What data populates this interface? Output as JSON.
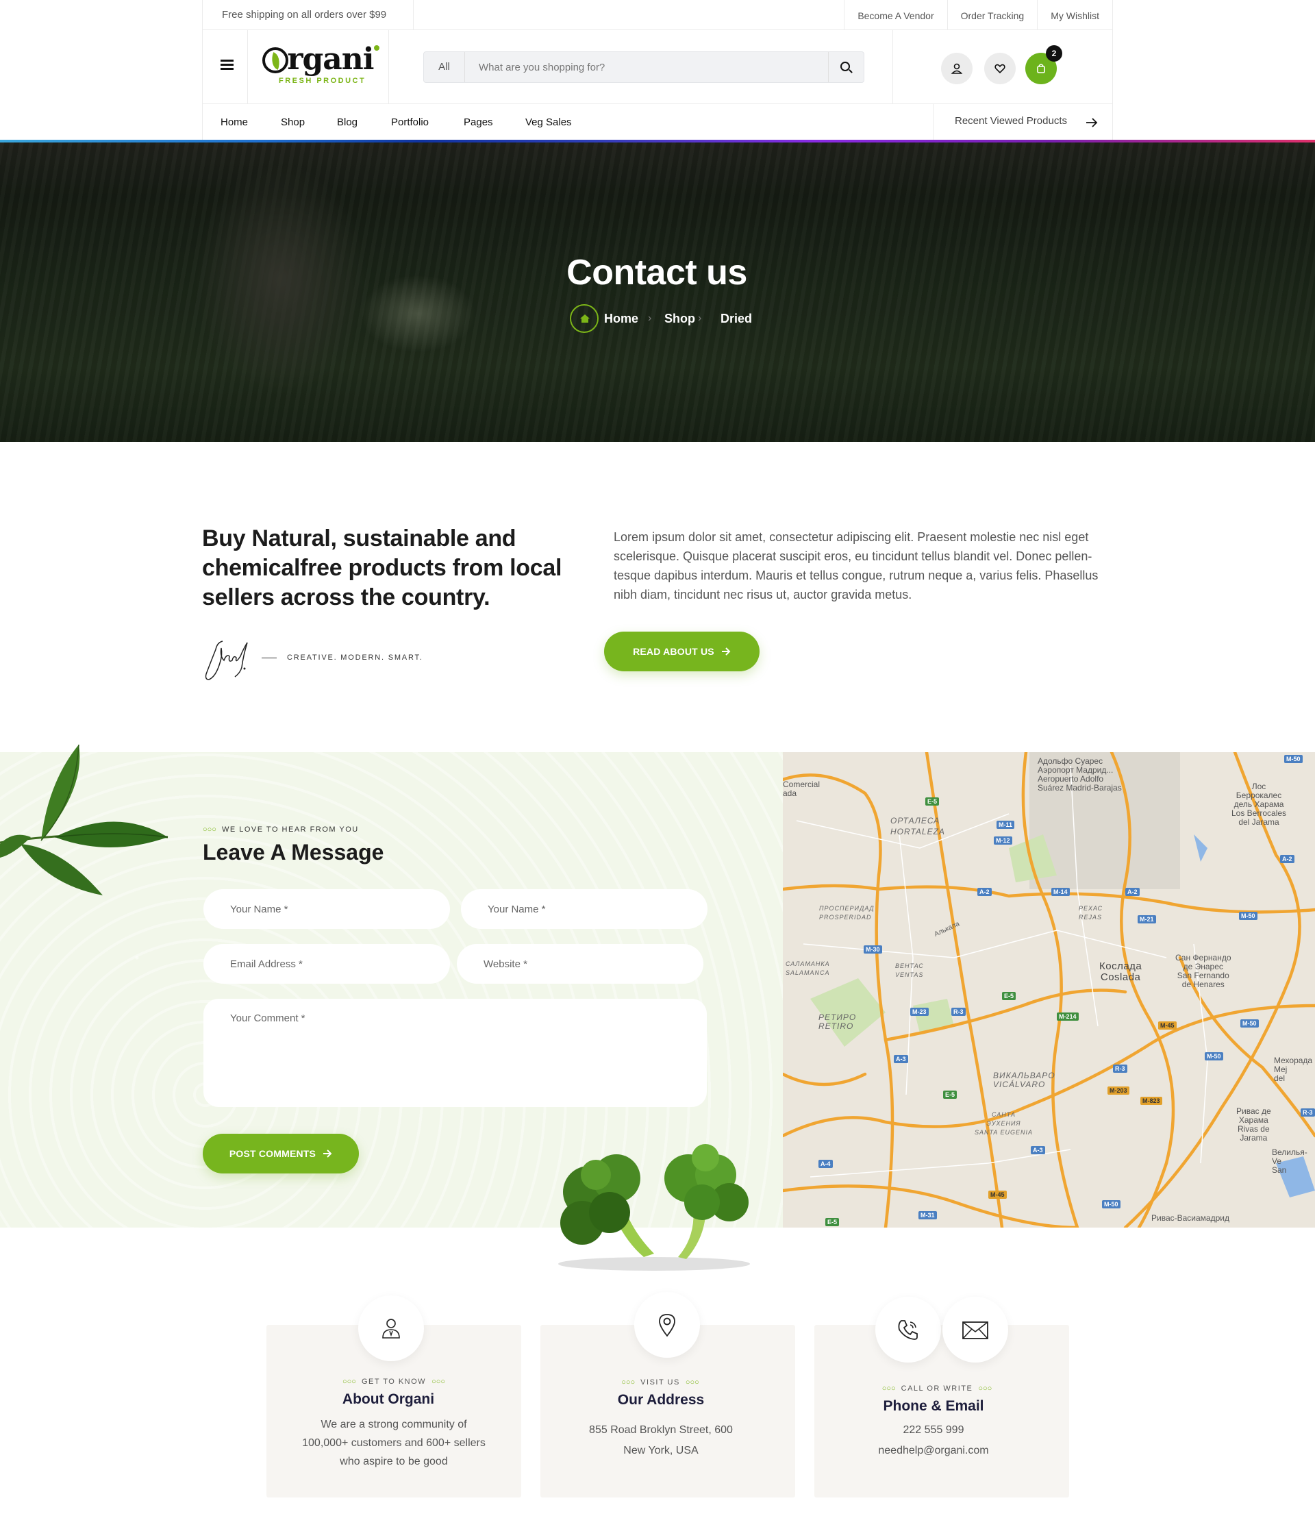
{
  "topbar": {
    "shipping": "Free shipping on all orders over $99",
    "links": [
      "Become A Vendor",
      "Order Tracking",
      "My Wishlist"
    ]
  },
  "header": {
    "logo_text": "Organi",
    "logo_tagline": "FRESH PRODUCT",
    "search_category": "All",
    "search_placeholder": "What are you shopping for?",
    "cart_count": "2",
    "accent": "#77b51e"
  },
  "nav": {
    "items": [
      "Home",
      "Shop",
      "Blog",
      "Portfolio",
      "Pages",
      "Veg Sales"
    ],
    "recent": "Recent Viewed Products"
  },
  "hero": {
    "title": "Contact us",
    "breadcrumb": [
      "Home",
      "Shop",
      "Dried"
    ]
  },
  "about": {
    "heading": "Buy Natural, sustainable and chemicalfree products from local sellers across the country.",
    "tagline": "CREATIVE. MODERN. SMART.",
    "paragraph": "Lorem ipsum dolor sit amet, consectetur adipiscing elit. Praesent molestie nec nisl eget scelerisque. Quisque placerat suscipit eros, eu tincidunt tellus blandit vel. Donec pellen-tesque dapibus interdum. Mauris et tellus congue, rutrum neque a, varius felis. Phasellus nibh diam, tincidunt nec risus ut, auctor gravida metus.",
    "button": "READ ABOUT US"
  },
  "message": {
    "subtitle": "WE LOVE TO HEAR FROM YOU",
    "title": "Leave A Message",
    "name_placeholder_1": "Your Name *",
    "name_placeholder_2": "Your Name *",
    "email_placeholder": "Email Address *",
    "website_placeholder": "Website *",
    "comment_placeholder": "Your Comment *",
    "button": "POST COMMENTS"
  },
  "map": {
    "labels": {
      "airport": "Адольфо Суарес\nАэропорт Мадрид...\nAeropuerto Adolfo\nSuárez Madrid-Barajas",
      "hortaleza": "ОРТАЛЕСА\nHORTALEZA",
      "berrocales": "Лос\nБеррокалес\nдель Харама\nLos Berrocales\ndel Jarama",
      "coslada": "Кослада\nCoslada",
      "sanfernando": "Сан Фернандо\nде Энарес\nSan Fernando\nde Henares",
      "retiro": "РЕТИРО\nRETIRO",
      "vicalvaro": "ВИКАЛЬВАРО\nVICÁLVARO",
      "rivas": "Ривас де\nХарама\nRivas de\nJarama",
      "rivas_bottom": "Ривас-Васиамадрид",
      "mejorada": "Мехорада\nMej\ndel",
      "velilla": "Велилья-\nVe\nSan",
      "comercial": "Comercial\nada",
      "prosperidad": "ПРОСПЕРИДАД\nPROSPERIDAD",
      "salamanca": "САЛАМАНКА\nSALAMANCA",
      "ventas": "ВЕНТАС\nVENTAS",
      "rejas": "РЕХАС\nREJAS",
      "santa_eugenia": "САНТА\nЭУХЕНИЯ\nSANTA EUGENIA",
      "alcala": "Алькала"
    }
  },
  "cards": [
    {
      "subtitle": "GET TO KNOW",
      "title": "About Organi",
      "text": [
        "We are a strong community of",
        "100,000+ customers and 600+ sellers",
        "who aspire to be good"
      ],
      "icon": "user-icon"
    },
    {
      "subtitle": "VISIT US",
      "title": "Our Address",
      "text": [
        "855 Road Broklyn Street, 600",
        "New York, USA"
      ],
      "icon": "location-pin-icon"
    },
    {
      "subtitle": "CALL OR WRITE",
      "title": "Phone & Email",
      "text": [
        "222 555 999",
        "needhelp@organi.com"
      ],
      "icon": "phone-icon"
    }
  ]
}
